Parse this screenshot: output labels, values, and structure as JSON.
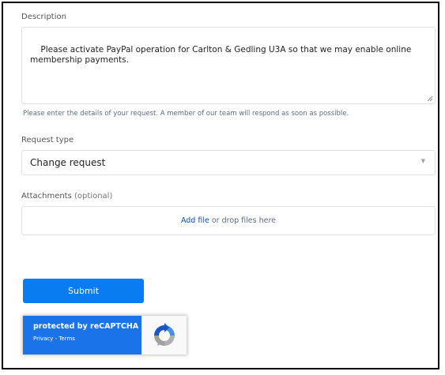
{
  "form": {
    "description": {
      "label": "Description",
      "value": "Please activate PayPal operation for Carlton & Gedling U3A so that we may enable online membership payments.",
      "hint": "Please enter the details of your request. A member of our team will respond as soon as possible."
    },
    "request_type": {
      "label": "Request type",
      "selected": "Change request",
      "chevron_icon": "chevron-down-icon"
    },
    "attachments": {
      "label": "Attachments",
      "optional": "(optional)",
      "add_file": "Add file",
      "drop_text": "or drop files here"
    },
    "submit_label": "Submit"
  },
  "recaptcha": {
    "title": "protected by reCAPTCHA",
    "privacy": "Privacy",
    "separator": " - ",
    "terms": "Terms",
    "icon": "recaptcha-logo-icon"
  },
  "colors": {
    "accent": "#0a7cf2",
    "link": "#0052cc",
    "recaptcha_blue": "#1a73e8",
    "border": "#dfe1e6"
  }
}
